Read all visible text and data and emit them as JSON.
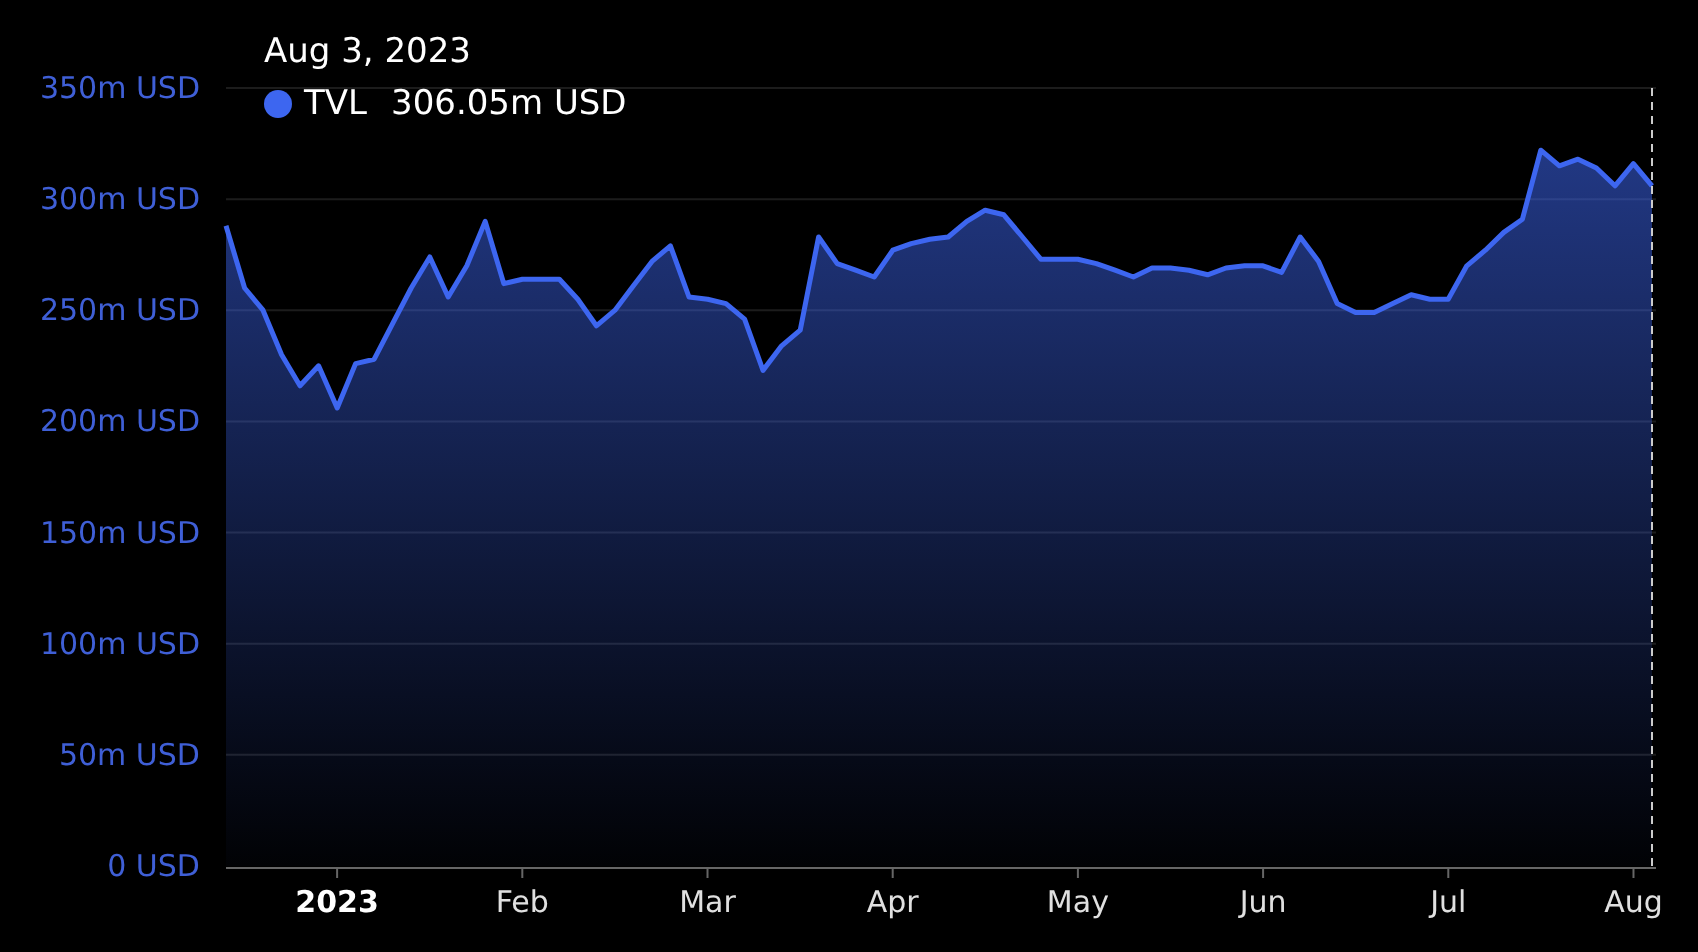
{
  "chart": {
    "tooltip": {
      "date": "Aug 3, 2023",
      "value": "306.05m USD"
    },
    "chart_data": {
      "type": "area",
      "categories": [
        null,
        null,
        null,
        null,
        null,
        null,
        "**2023**",
        null,
        null,
        null,
        null,
        null,
        null,
        null,
        null,
        null,
        "Feb",
        null,
        null,
        null,
        null,
        null,
        null,
        null,
        null,
        null,
        "Mar",
        null,
        null,
        null,
        null,
        null,
        null,
        null,
        null,
        null,
        "Apr",
        null,
        null,
        null,
        null,
        null,
        null,
        null,
        null,
        null,
        "May",
        null,
        null,
        null,
        null,
        null,
        null,
        null,
        null,
        null,
        "Jun",
        null,
        null,
        null,
        null,
        null,
        null,
        null,
        null,
        null,
        "Jul",
        null,
        null,
        null,
        null,
        null,
        null,
        null,
        null,
        null,
        "Aug",
        null
      ],
      "series": [
        {
          "name": "TVL",
          "color": "#3d66f0",
          "values": [
            288,
            260,
            250,
            230,
            216,
            225,
            206,
            226,
            228,
            244,
            260,
            274,
            256,
            270,
            290,
            262,
            264,
            264,
            264,
            255,
            243,
            250,
            261,
            272,
            279,
            256,
            255,
            253,
            246,
            223,
            234,
            241,
            283,
            271,
            268,
            265,
            277,
            280,
            282,
            283,
            290,
            295,
            293,
            283,
            273,
            273,
            273,
            271,
            268,
            265,
            269,
            269,
            268,
            266,
            269,
            270,
            270,
            267,
            283,
            272,
            253,
            249,
            249,
            253,
            257,
            255,
            255,
            270,
            277,
            285,
            291,
            322,
            315,
            318,
            314,
            306,
            316,
            306
          ]
        }
      ],
      "ylim": [
        0,
        350
      ],
      "grid": true,
      "yticks": [
        {
          "value": 0,
          "label": "0 USD"
        },
        {
          "value": 50,
          "label": "50m USD"
        },
        {
          "value": 100,
          "label": "100m USD"
        },
        {
          "value": 150,
          "label": "150m USD"
        },
        {
          "value": 200,
          "label": "200m USD"
        },
        {
          "value": 250,
          "label": "250m USD"
        },
        {
          "value": 300,
          "label": "300m USD"
        },
        {
          "value": 350,
          "label": "350m USD"
        }
      ]
    }
  }
}
